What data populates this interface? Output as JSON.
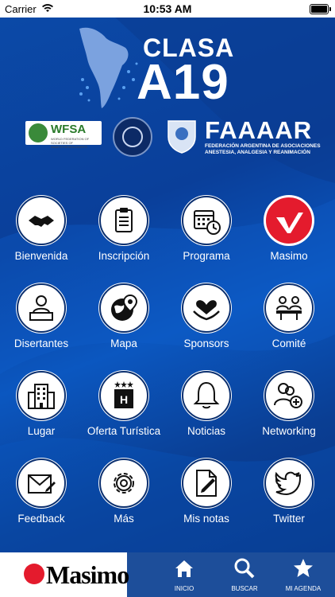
{
  "status_bar": {
    "carrier": "Carrier",
    "time": "10:53 AM"
  },
  "header": {
    "event_line1": "CLASA",
    "event_line2": "A19",
    "wfsa_label": "WFSA",
    "wfsa_sub": "WORLD FEDERATION OF SOCIETIES OF ANAESTHESIOLOGISTS",
    "faaaar_label": "FAAAAR",
    "faaaar_sub_line1": "FEDERACIÓN ARGENTINA DE ASOCIACIONES",
    "faaaar_sub_line2": "ANESTESIA, ANALGESIA Y REANIMACIÓN"
  },
  "menu": [
    {
      "label": "Bienvenida",
      "icon": "handshake-icon"
    },
    {
      "label": "Inscripción",
      "icon": "clipboard-icon"
    },
    {
      "label": "Programa",
      "icon": "calendar-clock-icon"
    },
    {
      "label": "Masimo",
      "icon": "masimo-logo-icon"
    },
    {
      "label": "Disertantes",
      "icon": "speaker-podium-icon"
    },
    {
      "label": "Mapa",
      "icon": "globe-pin-icon"
    },
    {
      "label": "Sponsors",
      "icon": "heart-hands-icon"
    },
    {
      "label": "Comité",
      "icon": "meeting-table-icon"
    },
    {
      "label": "Lugar",
      "icon": "building-icon"
    },
    {
      "label": "Oferta Turística",
      "icon": "hotel-icon"
    },
    {
      "label": "Noticias",
      "icon": "bell-icon"
    },
    {
      "label": "Networking",
      "icon": "add-user-icon"
    },
    {
      "label": "Feedback",
      "icon": "envelope-pencil-icon"
    },
    {
      "label": "Más",
      "icon": "gear-icon"
    },
    {
      "label": "Mis notas",
      "icon": "note-pencil-icon"
    },
    {
      "label": "Twitter",
      "icon": "twitter-bird-icon"
    }
  ],
  "tabbar": {
    "brand": "Masimo",
    "tabs": [
      {
        "label": "INICIO",
        "icon": "home-icon"
      },
      {
        "label": "BUSCAR",
        "icon": "search-icon"
      },
      {
        "label": "MI AGENDA",
        "icon": "star-icon"
      }
    ]
  },
  "colors": {
    "background": "#0b4aa8",
    "tabbar": "#1d4e9a",
    "masimo_red": "#e41b2d"
  }
}
